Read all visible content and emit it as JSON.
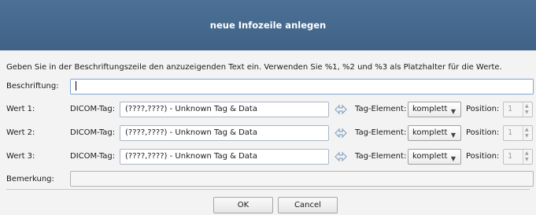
{
  "dialog": {
    "title": "neue Infozeile anlegen",
    "instruction": "Geben Sie in der Beschriftungszeile den anzuzeigenden Text ein. Verwenden Sie %1, %2 und %3 als Platzhalter für die Werte.",
    "caption_label": "Beschriftung:",
    "caption_value": "",
    "rows": [
      {
        "label": "Wert 1:",
        "dicom_label": "DICOM-Tag:",
        "dicom_value": "(????,????) - Unknown Tag & Data",
        "element_label": "Tag-Element:",
        "element_value": "komplett",
        "position_label": "Position:",
        "position_value": "1"
      },
      {
        "label": "Wert 2:",
        "dicom_label": "DICOM-Tag:",
        "dicom_value": "(????,????) - Unknown Tag & Data",
        "element_label": "Tag-Element:",
        "element_value": "komplett",
        "position_label": "Position:",
        "position_value": "1"
      },
      {
        "label": "Wert 3:",
        "dicom_label": "DICOM-Tag:",
        "dicom_value": "(????,????) - Unknown Tag & Data",
        "element_label": "Tag-Element:",
        "element_value": "komplett",
        "position_label": "Position:",
        "position_value": "1"
      }
    ],
    "remark_label": "Bemerkung:",
    "remark_value": "",
    "ok_label": "OK",
    "cancel_label": "Cancel"
  },
  "icons": {
    "swap": "swap-arrows-icon",
    "dropdown": "chevron-down-icon",
    "spin_up": "spin-up-icon",
    "spin_down": "spin-down-icon"
  },
  "colors": {
    "titlebar": "#456a8f",
    "title_text": "#ffffff",
    "swap_icon": "#8aa6c4"
  }
}
